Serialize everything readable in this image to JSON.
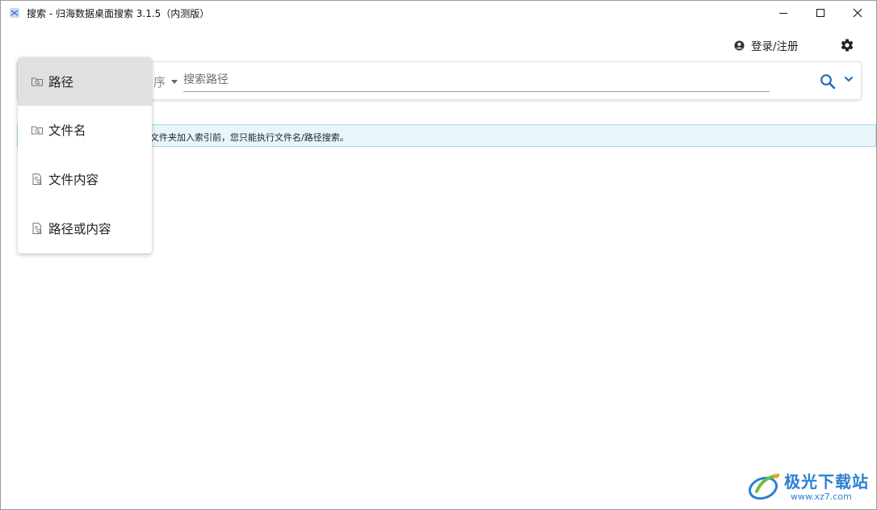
{
  "window": {
    "title": "搜索 - 归海数据桌面搜索 3.1.5（内测版）"
  },
  "header": {
    "login_label": "登录/注册",
    "icons": {
      "user": "user-circle-icon",
      "settings": "gear-icon"
    }
  },
  "search": {
    "sort_label": "序",
    "placeholder": "搜索路径",
    "value": ""
  },
  "banner": {
    "text": "文件夹加入索引前，您只能执行文件名/路径搜索。"
  },
  "search_mode_menu": {
    "selected": "路径",
    "items": [
      {
        "label": "路径",
        "icon": "folder-search-icon",
        "active": true
      },
      {
        "label": "文件名",
        "icon": "folder-search-icon",
        "active": false
      },
      {
        "label": "文件内容",
        "icon": "file-search-icon",
        "active": false
      },
      {
        "label": "路径或内容",
        "icon": "file-search-icon",
        "active": false
      }
    ]
  },
  "watermark": {
    "name": "极光下载站",
    "url": "www.xz7.com"
  },
  "colors": {
    "accent": "#1e6fb8",
    "banner_bg": "#e6f6fa",
    "banner_border": "#a9dbe7",
    "menu_active": "#e0e0e0"
  }
}
